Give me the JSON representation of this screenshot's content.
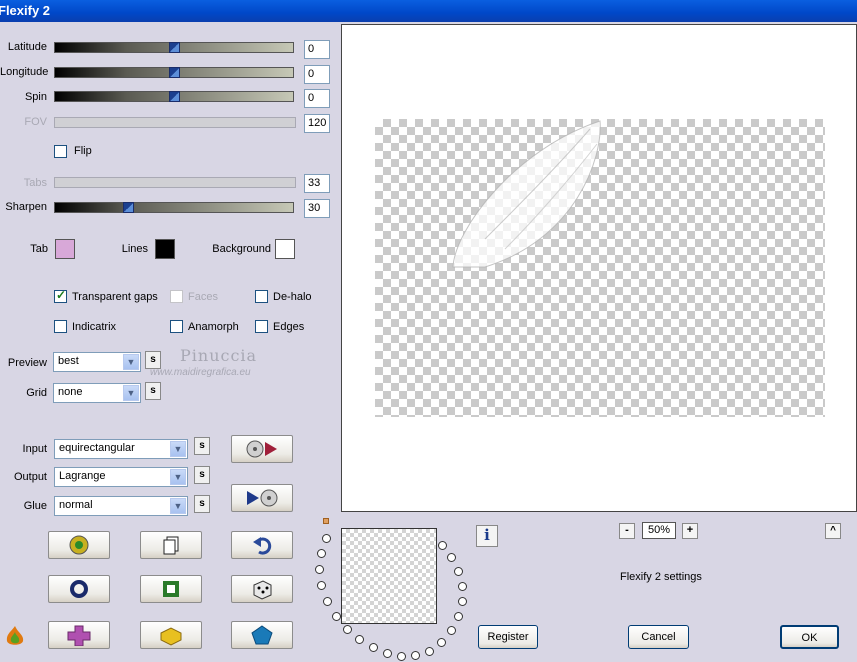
{
  "window": {
    "title": "Flexify 2"
  },
  "sliders": [
    {
      "label": "Latitude",
      "value": "0",
      "enabled": true,
      "pos": 0.5
    },
    {
      "label": "Longitude",
      "value": "0",
      "enabled": true,
      "pos": 0.5
    },
    {
      "label": "Spin",
      "value": "0",
      "enabled": true,
      "pos": 0.5
    },
    {
      "label": "FOV",
      "value": "120",
      "enabled": false
    },
    {
      "label": "Tabs",
      "value": "33",
      "enabled": false
    },
    {
      "label": "Sharpen",
      "value": "30",
      "enabled": true,
      "pos": 0.3
    }
  ],
  "flip": {
    "label": "Flip",
    "checked": false
  },
  "colors": {
    "tab": {
      "label": "Tab",
      "color": "#d8a8d8"
    },
    "lines": {
      "label": "Lines",
      "color": "#000000"
    },
    "background": {
      "label": "Background",
      "color": "#ffffff"
    }
  },
  "options": {
    "transparent_gaps": "Transparent gaps",
    "faces": "Faces",
    "de_halo": "De-halo",
    "indicatrix": "Indicatrix",
    "anamorph": "Anamorph",
    "edges": "Edges"
  },
  "selects": {
    "preview": {
      "label": "Preview",
      "value": "best"
    },
    "grid": {
      "label": "Grid",
      "value": "none"
    },
    "input": {
      "label": "Input",
      "value": "equirectangular"
    },
    "output": {
      "label": "Output",
      "value": "Lagrange"
    },
    "glue": {
      "label": "Glue",
      "value": "normal"
    },
    "s_label": "s"
  },
  "watermark": {
    "name": "Pinuccia",
    "url": "www.maidiregrafica.eu"
  },
  "zoom": {
    "minus": "-",
    "value": "50%",
    "plus": "+"
  },
  "status": "Flexify 2 settings",
  "buttons": {
    "register": "Register",
    "cancel": "Cancel",
    "ok": "OK",
    "up": "^",
    "info": "i"
  }
}
